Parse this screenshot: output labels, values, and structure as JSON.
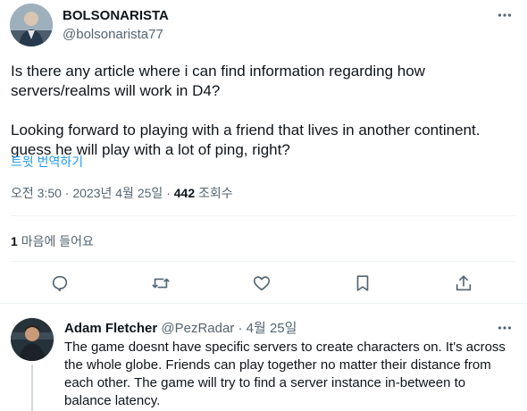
{
  "tweet": {
    "author_name": "BOLSONARISTA",
    "author_handle": "@bolsonarista77",
    "text": "Is there any article where i can find information regarding how\nservers/realms will work in D4?\n\nLooking forward to playing with a friend that lives in another continent.\nguess he will play with a lot of ping, right?",
    "translate_label": "트윗 번역하기",
    "time": "오전 3:50",
    "date": "2023년 4월 25일",
    "views_count": "442",
    "views_label": "조회수",
    "likes_count": "1",
    "likes_label": "마음에 들어요"
  },
  "actions": [
    "reply-icon",
    "retweet-icon",
    "like-icon",
    "bookmark-icon",
    "share-icon"
  ],
  "reply": {
    "author_name": "Adam Fletcher",
    "author_handle": "@PezRadar",
    "separator": "·",
    "date": "4월 25일",
    "text": "The game doesnt have specific servers to create characters on. It's across the whole globe. Friends can play together no matter their distance from each other. The game will try to find a server instance in-between to balance latency."
  },
  "colors": {
    "link": "#1d9bf0",
    "secondary": "#536471",
    "text": "#0f1419",
    "divider": "#eff3f4"
  }
}
